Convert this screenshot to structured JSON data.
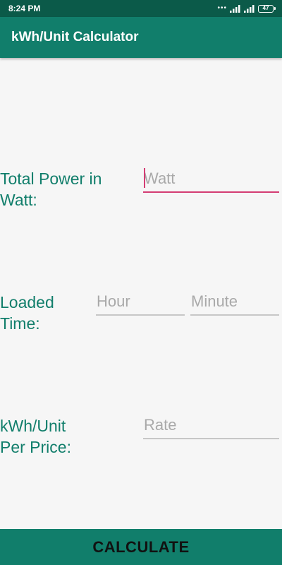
{
  "status_bar": {
    "time": "8:24 PM",
    "battery": "47",
    "icons": [
      "notification-dots-icon",
      "signal-icon",
      "signal-icon",
      "battery-icon"
    ]
  },
  "app_bar": {
    "title": "kWh/Unit Calculator"
  },
  "form": {
    "power_label_line1": "Total Power in",
    "power_label_line2": "Watt:",
    "watt_placeholder": "Watt",
    "time_label_line1": "Loaded",
    "time_label_line2": "Time:",
    "hour_placeholder": "Hour",
    "minute_placeholder": "Minute",
    "rate_label_line1": "kWh/Unit",
    "rate_label_line2": "Per Price:",
    "rate_placeholder": "Rate"
  },
  "calculate_button": {
    "label": "CALCULATE"
  },
  "colors": {
    "primary": "#117e6b",
    "primary_dark": "#0b5a49",
    "accent": "#d43c73",
    "background": "#f6f6f6"
  }
}
